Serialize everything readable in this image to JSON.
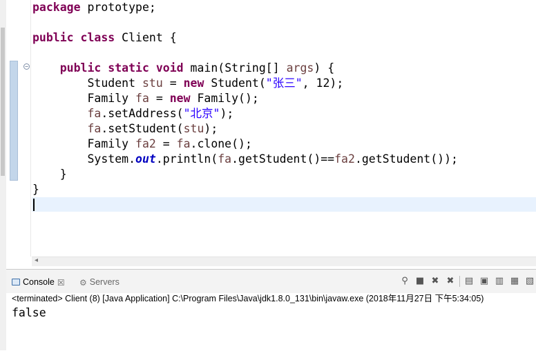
{
  "editor": {
    "lines": [
      {
        "segments": [
          {
            "text": "package",
            "style": "kw"
          },
          {
            "text": " prototype;"
          }
        ]
      },
      {
        "segments": [
          {
            "text": ""
          }
        ]
      },
      {
        "segments": [
          {
            "text": "public",
            "style": "kw"
          },
          {
            "text": " "
          },
          {
            "text": "class",
            "style": "kw"
          },
          {
            "text": " Client {"
          }
        ]
      },
      {
        "segments": [
          {
            "text": ""
          }
        ]
      },
      {
        "segments": [
          {
            "text": "    "
          },
          {
            "text": "public",
            "style": "kw"
          },
          {
            "text": " "
          },
          {
            "text": "static",
            "style": "kw"
          },
          {
            "text": " "
          },
          {
            "text": "void",
            "style": "kw"
          },
          {
            "text": " main(String[] "
          },
          {
            "text": "args",
            "style": "lv"
          },
          {
            "text": ") {"
          }
        ]
      },
      {
        "segments": [
          {
            "text": "        Student "
          },
          {
            "text": "stu",
            "style": "lv"
          },
          {
            "text": " = "
          },
          {
            "text": "new",
            "style": "kw"
          },
          {
            "text": " Student("
          },
          {
            "text": "\"张三\"",
            "style": "str"
          },
          {
            "text": ", 12);"
          }
        ]
      },
      {
        "segments": [
          {
            "text": "        Family "
          },
          {
            "text": "fa",
            "style": "lv"
          },
          {
            "text": " = "
          },
          {
            "text": "new",
            "style": "kw"
          },
          {
            "text": " Family();"
          }
        ]
      },
      {
        "segments": [
          {
            "text": "        "
          },
          {
            "text": "fa",
            "style": "lv"
          },
          {
            "text": ".setAddress("
          },
          {
            "text": "\"北京\"",
            "style": "str"
          },
          {
            "text": ");"
          }
        ]
      },
      {
        "segments": [
          {
            "text": "        "
          },
          {
            "text": "fa",
            "style": "lv"
          },
          {
            "text": ".setStudent("
          },
          {
            "text": "stu",
            "style": "lv"
          },
          {
            "text": ");"
          }
        ]
      },
      {
        "segments": [
          {
            "text": "        Family "
          },
          {
            "text": "fa2",
            "style": "lv"
          },
          {
            "text": " = "
          },
          {
            "text": "fa",
            "style": "lv"
          },
          {
            "text": ".clone();"
          }
        ]
      },
      {
        "segments": [
          {
            "text": "        System."
          },
          {
            "text": "out",
            "style": "fld"
          },
          {
            "text": ".println("
          },
          {
            "text": "fa",
            "style": "lv"
          },
          {
            "text": ".getStudent()=="
          },
          {
            "text": "fa2",
            "style": "lv"
          },
          {
            "text": ".getStudent());"
          }
        ]
      },
      {
        "segments": [
          {
            "text": "    }"
          }
        ]
      },
      {
        "segments": [
          {
            "text": "}"
          }
        ]
      },
      {
        "segments": [
          {
            "text": ""
          }
        ]
      }
    ]
  },
  "console": {
    "tabs": [
      {
        "label": "Console",
        "icon": "console-icon",
        "active": true
      },
      {
        "label": "Servers",
        "icon": "servers-icon",
        "active": false
      }
    ],
    "toolbar": [
      {
        "name": "pin-icon",
        "glyph": "⚲"
      },
      {
        "name": "terminate-icon",
        "glyph": "■"
      },
      {
        "name": "remove-launch-icon",
        "glyph": "✖"
      },
      {
        "name": "remove-all-icon",
        "glyph": "✖"
      },
      {
        "name": "clear-console-icon",
        "glyph": "▤"
      },
      {
        "name": "scroll-lock-icon",
        "glyph": "▣"
      },
      {
        "name": "word-wrap-icon",
        "glyph": "▥"
      },
      {
        "name": "show-on-output-icon",
        "glyph": "▦"
      },
      {
        "name": "open-console-icon",
        "glyph": "▧"
      }
    ],
    "status": "<terminated> Client (8) [Java Application] C:\\Program Files\\Java\\jdk1.8.0_131\\bin\\javaw.exe (2018年11月27日 下午5:34:05)",
    "output": "false"
  },
  "colors": {
    "keyword": "#7f0055",
    "string": "#2a00ff",
    "static_field": "#0000c0",
    "local_variable": "#6a3e3e",
    "current_line": "#e8f2fe"
  }
}
